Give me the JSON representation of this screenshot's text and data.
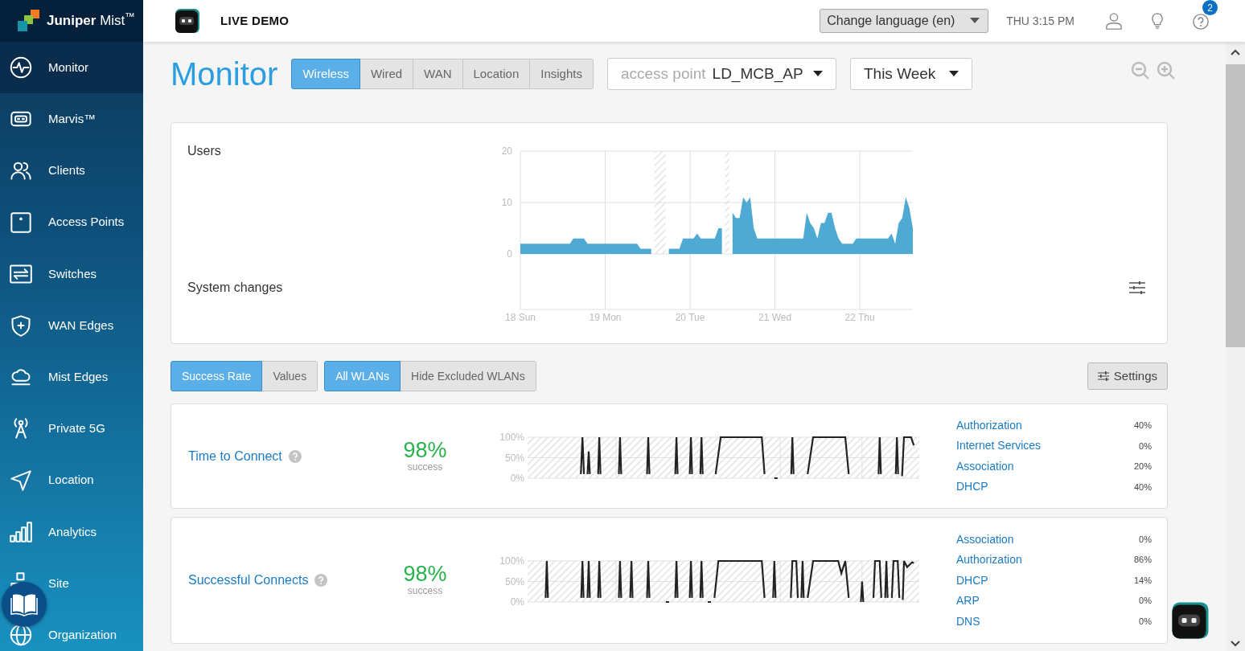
{
  "brand": {
    "logo_text": "**Juniper** Mist$^{™}$"
  },
  "header": {
    "title": "LIVE DEMO",
    "language": "Change language (en)",
    "time": "THU 3:15 PM",
    "help_badge": "2"
  },
  "sidebar": {
    "items": [
      {
        "label": "Monitor",
        "selected": true
      },
      {
        "label": "Marvis™",
        "selected": false
      },
      {
        "label": "Clients",
        "selected": false
      },
      {
        "label": "Access Points",
        "selected": false
      },
      {
        "label": "Switches",
        "selected": false
      },
      {
        "label": "WAN Edges",
        "selected": false
      },
      {
        "label": "Mist Edges",
        "selected": false
      },
      {
        "label": "Private 5G",
        "selected": false
      },
      {
        "label": "Location",
        "selected": false
      },
      {
        "label": "Analytics",
        "selected": false
      },
      {
        "label": "Site",
        "selected": false
      },
      {
        "label": "Organization",
        "selected": false
      }
    ]
  },
  "page": {
    "title": "Monitor",
    "tabs": [
      {
        "label": "Wireless",
        "selected": true
      },
      {
        "label": "Wired",
        "selected": false
      },
      {
        "label": "WAN",
        "selected": false
      },
      {
        "label": "Location",
        "selected": false
      },
      {
        "label": "Insights",
        "selected": false
      }
    ],
    "filter": {
      "label": "access point",
      "value": "LD_MCB_AP"
    },
    "period": "This Week"
  },
  "users_card": {
    "system_changes": "System changes",
    "chart_data": {
      "type": "area",
      "title": "Users",
      "grid": true,
      "ylim": [
        0,
        20
      ],
      "yticks": [
        0,
        10,
        20
      ],
      "categories": [
        "18 Sun",
        null,
        null,
        null,
        null,
        null,
        null,
        null,
        null,
        null,
        null,
        null,
        null,
        null,
        null,
        null,
        null,
        null,
        null,
        null,
        null,
        null,
        null,
        null,
        "19 Mon",
        null,
        null,
        null,
        null,
        null,
        null,
        null,
        null,
        null,
        null,
        null,
        null,
        null,
        null,
        null,
        null,
        null,
        null,
        null,
        null,
        null,
        null,
        null,
        "20 Tue",
        null,
        null,
        null,
        null,
        null,
        null,
        null,
        null,
        null,
        null,
        null,
        null,
        null,
        null,
        null,
        null,
        null,
        null,
        null,
        null,
        null,
        null,
        null,
        "21 Wed",
        null,
        null,
        null,
        null,
        null,
        null,
        null,
        null,
        null,
        null,
        null,
        null,
        null,
        null,
        null,
        null,
        null,
        null,
        null,
        null,
        null,
        null,
        null,
        "22 Thu",
        null,
        null,
        null,
        null,
        null,
        null,
        null,
        null,
        null,
        null,
        null,
        null,
        null,
        null,
        null
      ],
      "values": [
        2,
        2,
        2,
        2,
        2,
        2,
        2,
        2,
        2,
        2,
        2,
        2,
        2,
        2,
        2,
        3,
        3,
        3,
        3,
        2,
        2,
        2,
        2,
        2,
        2,
        2,
        2,
        2,
        2,
        2,
        2,
        2,
        2,
        2,
        1,
        1,
        1,
        1,
        null,
        null,
        null,
        null,
        1,
        1,
        1,
        1,
        3,
        3,
        3,
        3,
        4,
        3,
        3,
        3,
        3,
        3,
        5,
        5,
        null,
        null,
        8,
        7,
        7,
        11,
        10,
        11,
        5,
        3,
        3,
        3,
        3,
        3,
        3,
        3,
        3,
        3,
        3,
        3,
        3,
        3,
        3,
        8,
        6,
        5,
        3,
        6,
        6,
        8,
        8,
        5,
        3,
        2,
        2,
        2,
        2,
        3,
        3,
        3,
        3,
        3,
        3,
        3,
        3,
        3,
        3,
        4,
        2,
        6,
        7,
        11,
        9,
        5
      ]
    }
  },
  "toggles": [
    {
      "options": [
        {
          "label": "Success Rate",
          "selected": true
        },
        {
          "label": "Values",
          "selected": false
        }
      ]
    },
    {
      "options": [
        {
          "label": "All WLANs",
          "selected": true
        },
        {
          "label": "Hide Excluded WLANs",
          "selected": false
        }
      ]
    }
  ],
  "settings_button": "Settings",
  "metrics": [
    {
      "name": "Time to Connect",
      "value": "98%",
      "caption": "success",
      "axis_labels": [
        "100%",
        "50%",
        "0%"
      ],
      "classifiers": [
        {
          "name": "Authorization",
          "value": "40%"
        },
        {
          "name": "Internet Services",
          "value": "0%"
        },
        {
          "name": "Association",
          "value": "20%"
        },
        {
          "name": "DHCP",
          "value": "40%"
        }
      ]
    },
    {
      "name": "Successful Connects",
      "value": "98%",
      "caption": "success",
      "axis_labels": [
        "100%",
        "50%",
        "0%"
      ],
      "classifiers": [
        {
          "name": "Association",
          "value": "0%"
        },
        {
          "name": "Authorization",
          "value": "86%"
        },
        {
          "name": "DHCP",
          "value": "14%"
        },
        {
          "name": "ARP",
          "value": "0%"
        },
        {
          "name": "DNS",
          "value": "0%"
        }
      ]
    }
  ]
}
